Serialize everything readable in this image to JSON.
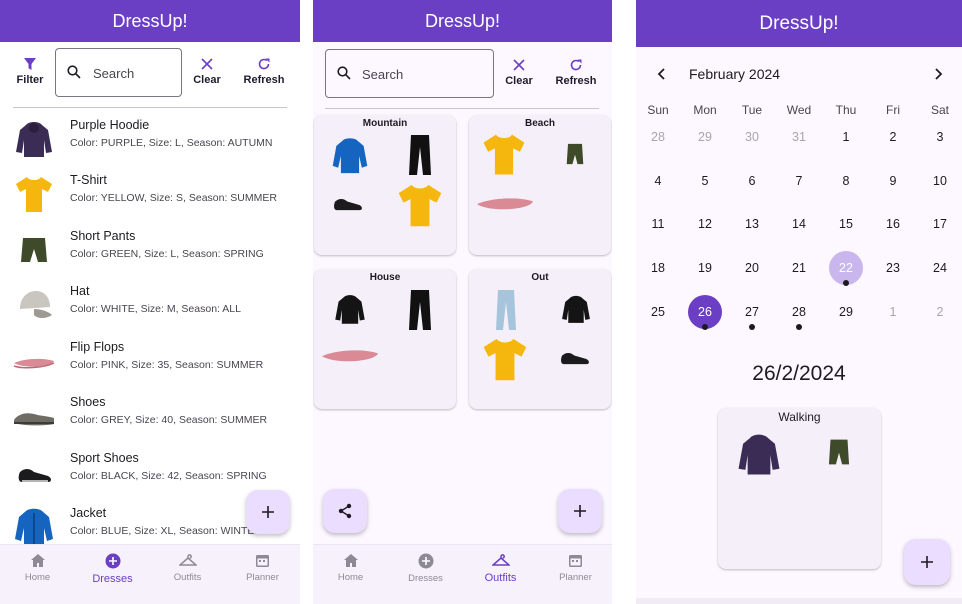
{
  "app": {
    "title": "DressUp!"
  },
  "toolbar": {
    "filter_label": "Filter",
    "clear_label": "Clear",
    "refresh_label": "Refresh",
    "search_placeholder": "Search"
  },
  "dresses": [
    {
      "name": "Purple Hoodie",
      "desc": "Color: PURPLE, Size: L, Season: AUTUMN",
      "icon": "hoodie-icon",
      "color": "#3b2c55"
    },
    {
      "name": "T-Shirt",
      "desc": "Color: YELLOW, Size: S, Season: SUMMER",
      "icon": "tshirt-icon",
      "color": "#f5b70d"
    },
    {
      "name": "Short Pants",
      "desc": "Color: GREEN, Size: L, Season: SPRING",
      "icon": "shorts-icon",
      "color": "#3f4a2a"
    },
    {
      "name": "Hat",
      "desc": "Color: WHITE, Size: M, Season: ALL",
      "icon": "hat-icon",
      "color": "#c9c6c0"
    },
    {
      "name": "Flip Flops",
      "desc": "Color: PINK, Size: 35, Season: SUMMER",
      "icon": "flip-flops-icon",
      "color": "#d98a95"
    },
    {
      "name": "Shoes",
      "desc": "Color: GREY, Size: 40, Season: SUMMER",
      "icon": "shoes-icon",
      "color": "#6f6c66"
    },
    {
      "name": "Sport Shoes",
      "desc": "Color: BLACK, Size: 42, Season: SPRING",
      "icon": "sport-shoes-icon",
      "color": "#1b1b1e"
    },
    {
      "name": "Jacket",
      "desc": "Color: BLUE, Size: XL, Season: WINTER",
      "icon": "jacket-icon",
      "color": "#1565c0"
    }
  ],
  "nav": {
    "home": "Home",
    "dresses": "Dresses",
    "outfits": "Outfits",
    "planner": "Planner"
  },
  "outfits": [
    {
      "title": "Mountain"
    },
    {
      "title": "Beach"
    },
    {
      "title": "House"
    },
    {
      "title": "Out"
    }
  ],
  "calendar": {
    "month_label": "February 2024",
    "weekdays": [
      "Sun",
      "Mon",
      "Tue",
      "Wed",
      "Thu",
      "Fri",
      "Sat"
    ],
    "weeks": [
      [
        "28",
        "29",
        "30",
        "31",
        "1",
        "2",
        "3"
      ],
      [
        "4",
        "5",
        "6",
        "7",
        "8",
        "9",
        "10"
      ],
      [
        "11",
        "12",
        "13",
        "14",
        "15",
        "16",
        "17"
      ],
      [
        "18",
        "19",
        "20",
        "21",
        "22",
        "23",
        "24"
      ],
      [
        "25",
        "26",
        "27",
        "28",
        "29",
        "1",
        "2"
      ]
    ],
    "today": "22",
    "selected": "26",
    "event_days": [
      "22",
      "26",
      "27",
      "28"
    ],
    "selected_date": "26/2/2024",
    "plan_title": "Walking"
  },
  "colors": {
    "primary": "#6b3fc4",
    "fab": "#eaddff",
    "card": "#f4eff9"
  }
}
